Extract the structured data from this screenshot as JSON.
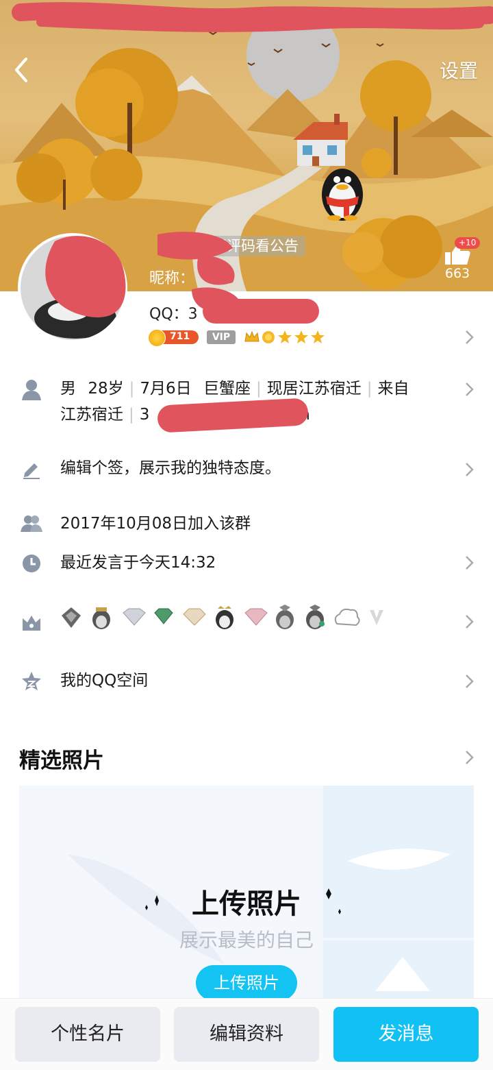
{
  "header": {
    "settings_label": "设置",
    "notice": "好评码看公告",
    "nickname_label": "昵称：",
    "like_badge": "+10",
    "like_count": "663"
  },
  "profile": {
    "qq_label": "QQ：3",
    "level": "711",
    "vip_label": "VIP"
  },
  "info": {
    "basic_line1": [
      "男",
      "28岁",
      "7月6日",
      "巨蟹座",
      "现居江苏宿迁",
      "来自"
    ],
    "basic_line2": [
      "江苏宿迁",
      "3",
      "m"
    ],
    "signature": "编辑个签，展示我的独特态度。",
    "joined_group": "2017年10月08日加入该群",
    "last_spoke": "最近发言于今天14:32",
    "qzone": "我的QQ空间"
  },
  "photos": {
    "section_title": "精选照片",
    "upload_title": "上传照片",
    "upload_subtitle": "展示最美的自己",
    "upload_button": "上传照片"
  },
  "bottom_bar": {
    "card_label": "个性名片",
    "edit_label": "编辑资料",
    "message_label": "发消息"
  },
  "colors": {
    "accent": "#12c1f3",
    "header_sky": "#d8b06a",
    "scribble": "#e0555d"
  }
}
